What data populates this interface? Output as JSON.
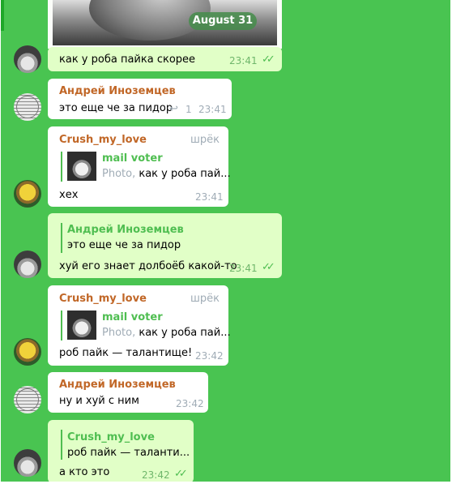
{
  "date_badge": "August 31",
  "colors": {
    "chat_background": "#49c451",
    "incoming_bubble": "#ffffff",
    "outgoing_bubble": "#e1ffc7",
    "sender_name": "#c16727",
    "reply_accent": "#4fbe51",
    "meta_gray": "#a0acb6"
  },
  "messages": [
    {
      "text": "как у роба пайка скорее",
      "time": "23:41",
      "read_icon": "double-check-icon"
    },
    {
      "sender": "Андрей Иноземцев",
      "text": "это еще че за пидор",
      "time": "23:41",
      "forward_icon": "reply-arrow-icon",
      "forward_count": "1"
    },
    {
      "sender": "Crush_my_love",
      "tag": "шрёк",
      "reply": {
        "name": "mail voter",
        "photo_label": "Photo,",
        "text": "как у роба пай..."
      },
      "text": "хех",
      "time": "23:41"
    },
    {
      "reply": {
        "name": "Андрей Иноземцев",
        "text": "это еще че за пидор"
      },
      "text": "хуй его знает долбоёб какой-то",
      "time": "23:41",
      "read_icon": "double-check-icon"
    },
    {
      "sender": "Crush_my_love",
      "tag": "шрёк",
      "reply": {
        "name": "mail voter",
        "photo_label": "Photo,",
        "text": "как у роба пай..."
      },
      "text": "роб пайк — талантище!",
      "time": "23:42"
    },
    {
      "sender": "Андрей Иноземцев",
      "text": "ну и хуй с ним",
      "time": "23:42"
    },
    {
      "reply": {
        "name": "Crush_my_love",
        "text": "роб пайк — таланти..."
      },
      "text": "а кто это",
      "time": "23:42",
      "read_icon": "double-check-icon"
    }
  ]
}
